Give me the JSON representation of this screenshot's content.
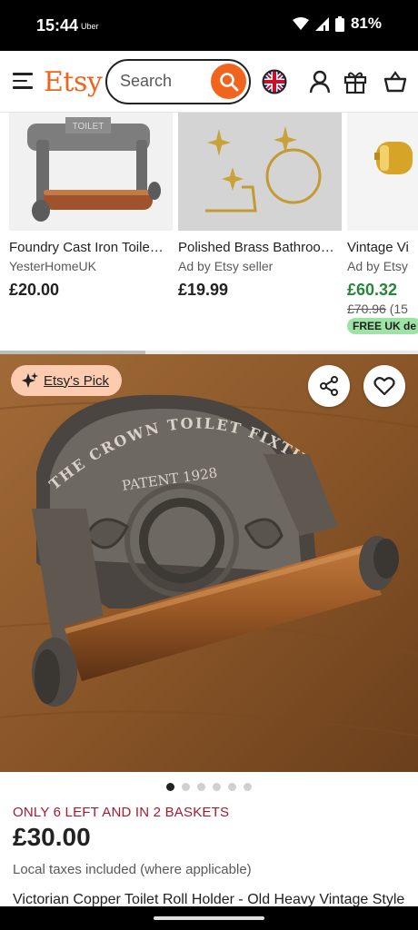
{
  "status_bar": {
    "time": "15:44",
    "carrier": "Uber",
    "battery": "81%"
  },
  "header": {
    "logo": "Etsy",
    "search_placeholder": "Search",
    "icons": [
      "menu-icon",
      "search-icon",
      "uk-flag-icon",
      "account-icon",
      "gift-icon",
      "basket-icon"
    ]
  },
  "products": [
    {
      "title": "Foundry Cast Iron Toile…",
      "sub": "YesterHomeUK",
      "price": "£20.00",
      "badge_text": "TOILET"
    },
    {
      "title": "Polished Brass Bathroo…",
      "sub": "Ad by Etsy seller",
      "price": "£19.99"
    },
    {
      "title": "Vintage Vi",
      "sub": "Ad by Etsy",
      "price": "£60.32",
      "original_price": "£70.96",
      "discount": "(15",
      "badge": "FREE UK de"
    }
  ],
  "hero": {
    "pick_label": "Etsy's Pick",
    "plate_text_top": "THE CROWN TOILET FIXTURE",
    "plate_text_patent": "PATENT 1928"
  },
  "gallery": {
    "total": 6,
    "active": 0
  },
  "listing": {
    "stock_notice": "ONLY 6 LEFT AND IN 2 BASKETS",
    "price": "£30.00",
    "taxes": "Local taxes included (where applicable)",
    "title": "Victorian Copper Toilet Roll Holder - Old Heavy Vintage Style"
  },
  "colors": {
    "brand": "#f1641e",
    "sale": "#258635",
    "stock": "#a61a2e",
    "pick_bg": "#fccbb0"
  }
}
